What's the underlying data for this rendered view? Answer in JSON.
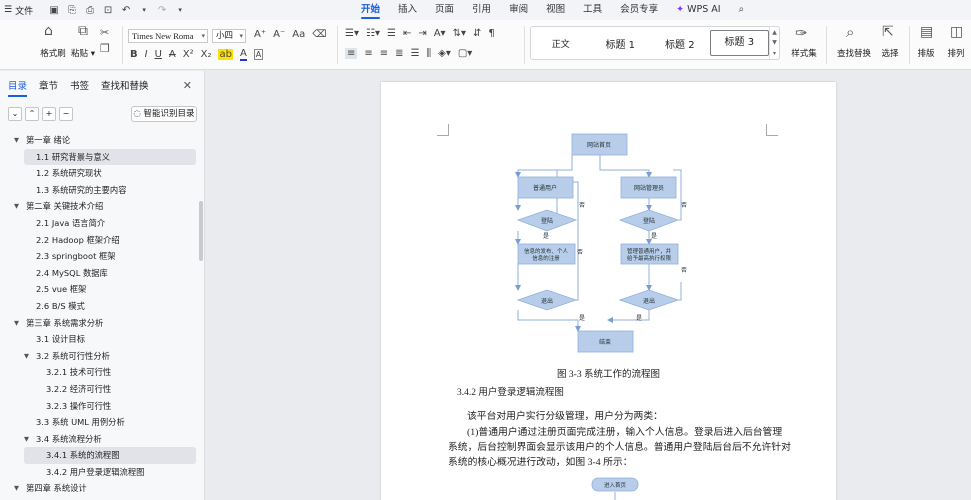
{
  "menubar": {
    "file_label": "文件",
    "tabs": [
      "开始",
      "插入",
      "页面",
      "引用",
      "审阅",
      "视图",
      "工具",
      "会员专享"
    ],
    "active_tab": "开始",
    "wps_ai": "WPS AI"
  },
  "ribbon": {
    "format_painter": "格式刷",
    "paste": "粘贴",
    "font_name": "Times New Roma",
    "font_size": "小四",
    "styles": [
      "正文",
      "标题 1",
      "标题 2",
      "标题 3"
    ],
    "selected_style": "标题 3",
    "style_set": "样式集",
    "find_replace": "查找替换",
    "select": "选择",
    "layout": "排版",
    "arrange": "排列"
  },
  "nav": {
    "tabs": [
      "目录",
      "章节",
      "书签",
      "查找和替换"
    ],
    "smart_toc": "智能识别目录",
    "items": [
      {
        "label": "第一章  绪论",
        "level": 0,
        "expanded": true
      },
      {
        "label": "1.1 研究背景与意义",
        "level": 1
      },
      {
        "label": "1.2 系统研究现状",
        "level": 1
      },
      {
        "label": "1.3 系统研究的主要内容",
        "level": 1
      },
      {
        "label": "第二章  关键技术介绍",
        "level": 0,
        "expanded": true
      },
      {
        "label": "2.1 Java 语言简介",
        "level": 1
      },
      {
        "label": "2.2 Hadoop 框架介绍",
        "level": 1
      },
      {
        "label": "2.3 springboot 框架",
        "level": 1
      },
      {
        "label": "2.4 MySQL 数据库",
        "level": 1
      },
      {
        "label": "2.5 vue 框架",
        "level": 1
      },
      {
        "label": "2.6 B/S 模式",
        "level": 1
      },
      {
        "label": "第三章  系统需求分析",
        "level": 0,
        "expanded": true
      },
      {
        "label": "3.1 设计目标",
        "level": 1
      },
      {
        "label": "3.2 系统可行性分析",
        "level": 1,
        "expanded": true
      },
      {
        "label": "3.2.1 技术可行性",
        "level": 2
      },
      {
        "label": "3.2.2 经济可行性",
        "level": 2
      },
      {
        "label": "3.2.3 操作可行性",
        "level": 2
      },
      {
        "label": "3.3 系统 UML 用例分析",
        "level": 1
      },
      {
        "label": "3.4 系统流程分析",
        "level": 1,
        "expanded": true
      },
      {
        "label": "3.4.1 系统的流程图",
        "level": 2,
        "selected": true
      },
      {
        "label": "3.4.2 用户登录逻辑流程图",
        "level": 2
      },
      {
        "label": "第四章  系统设计",
        "level": 0,
        "expanded": true
      }
    ]
  },
  "document": {
    "flow": {
      "home": "网站首页",
      "user": "普通用户",
      "admin": "网站管理员",
      "login": "登陆",
      "user_action_1": "信息的发布、个人",
      "user_action_2": "信息的注册",
      "admin_action_1": "管理普通用户，并",
      "admin_action_2": "给予最高执行权限",
      "logout": "退出",
      "end": "结束",
      "yes": "是",
      "no": "否",
      "next_home": "进入首页"
    },
    "caption": "图 3-3   系统工作的流程图",
    "heading": "3.4.2 用户登录逻辑流程图",
    "para1": "该平台对用户实行分级管理，用户分为两类：",
    "para2": "(1)普通用户通过注册页面完成注册，输入个人信息。登录后进入后台管理",
    "para3": "系统，后台控制界面会显示该用户的个人信息。普通用户登陆后台后不允许针对",
    "para4": "系统的核心概况进行改动，如图 3-4 所示："
  }
}
